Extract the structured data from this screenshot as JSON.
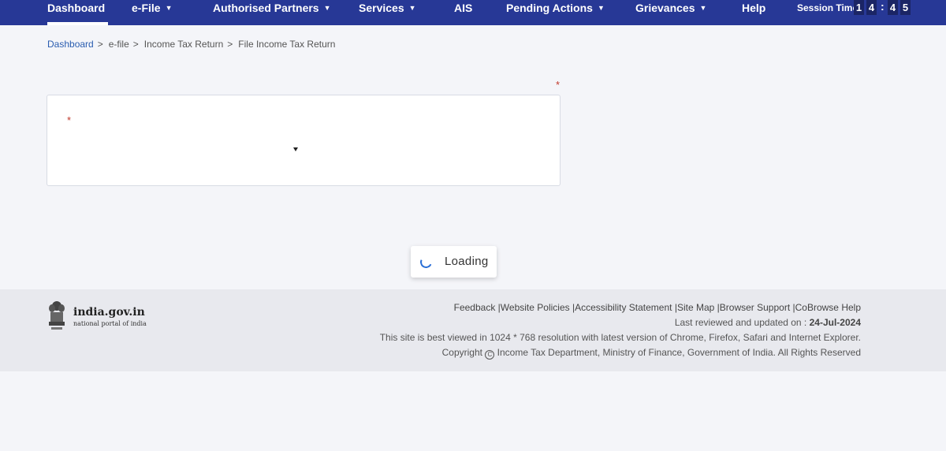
{
  "nav": {
    "items": [
      {
        "label": "Dashboard",
        "has_dropdown": false,
        "active": true
      },
      {
        "label": "e-File",
        "has_dropdown": true
      },
      {
        "label": "Authorised Partners",
        "has_dropdown": true
      },
      {
        "label": "Services",
        "has_dropdown": true
      },
      {
        "label": "AIS",
        "has_dropdown": false
      },
      {
        "label": "Pending Actions",
        "has_dropdown": true
      },
      {
        "label": "Grievances",
        "has_dropdown": true
      },
      {
        "label": "Help",
        "has_dropdown": false
      }
    ],
    "session_label": "Session Time",
    "session_digits": [
      "1",
      "4",
      "4",
      "5"
    ],
    "session_colon": ":"
  },
  "breadcrumb": {
    "items": [
      "Dashboard",
      "e-file",
      "Income Tax Return",
      "File Income Tax Return"
    ],
    "separator": ">"
  },
  "form": {
    "required_marker": "*"
  },
  "loading": {
    "text": "Loading"
  },
  "footer": {
    "logo_title": "india.gov.in",
    "logo_subtitle": "national portal of india",
    "links": [
      "Feedback",
      "Website Policies",
      "Accessibility Statement",
      "Site Map",
      "Browser Support",
      "CoBrowse Help"
    ],
    "link_separator": "|",
    "last_reviewed_label": "Last reviewed and updated on :",
    "last_reviewed_date": "24-Jul-2024",
    "best_viewed": "This site is best viewed in 1024 * 768 resolution with latest version of Chrome, Firefox, Safari and Internet Explorer.",
    "copyright_label": "Copyright",
    "copyright_symbol": "C",
    "copyright_text": "Income Tax Department, Ministry of Finance, Government of India. All Rights Reserved"
  },
  "colors": {
    "nav_bg": "#273896",
    "link": "#2a5db0",
    "required": "#c0392b",
    "spinner": "#2a6fd6"
  },
  "icons": {
    "dropdown": "chevron-down-icon",
    "select_arrow": "caret-down-icon",
    "spinner": "loading-spinner-icon",
    "emblem": "national-emblem-icon",
    "copyright": "copyright-icon"
  }
}
